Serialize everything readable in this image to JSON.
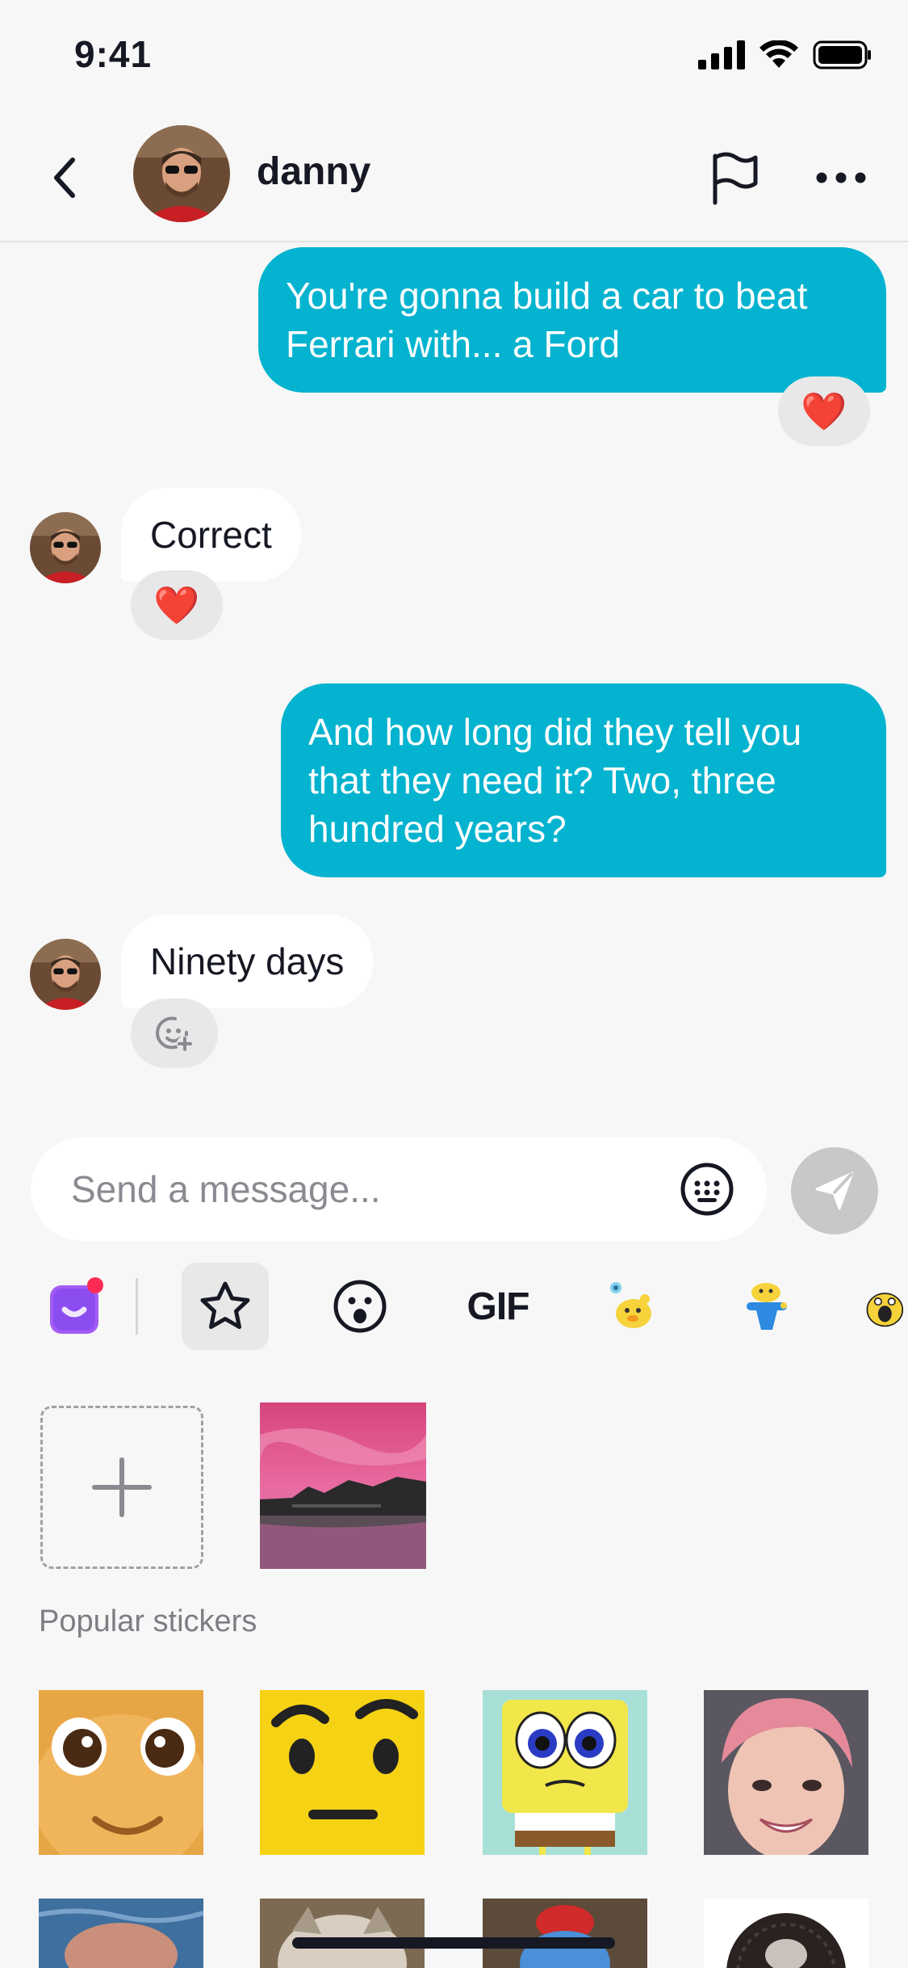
{
  "status_bar": {
    "time": "9:41"
  },
  "header": {
    "contact_name": "danny"
  },
  "messages": [
    {
      "direction": "outgoing",
      "text": "You're gonna build a car to beat Ferrari with... a Ford",
      "reaction": "❤️"
    },
    {
      "direction": "incoming",
      "text": "Correct",
      "reaction": "❤️"
    },
    {
      "direction": "outgoing",
      "text": "And how long did they tell you that they need it? Two, three hundred years?"
    },
    {
      "direction": "incoming",
      "text": "Ninety days",
      "reaction": "add-reaction"
    }
  ],
  "composer": {
    "placeholder": "Send a message..."
  },
  "sticker_tabs": {
    "items": [
      "my-stickers",
      "favorites",
      "emoji",
      "GIF",
      "sticker-pack-1",
      "sticker-pack-2",
      "sticker-pack-3"
    ],
    "active": "favorites",
    "gif_label": "GIF"
  },
  "sections": {
    "popular_title": "Popular stickers"
  },
  "colors": {
    "accent": "#03b3cf",
    "background": "#f7f7f7",
    "badge": "#fe2c55"
  }
}
